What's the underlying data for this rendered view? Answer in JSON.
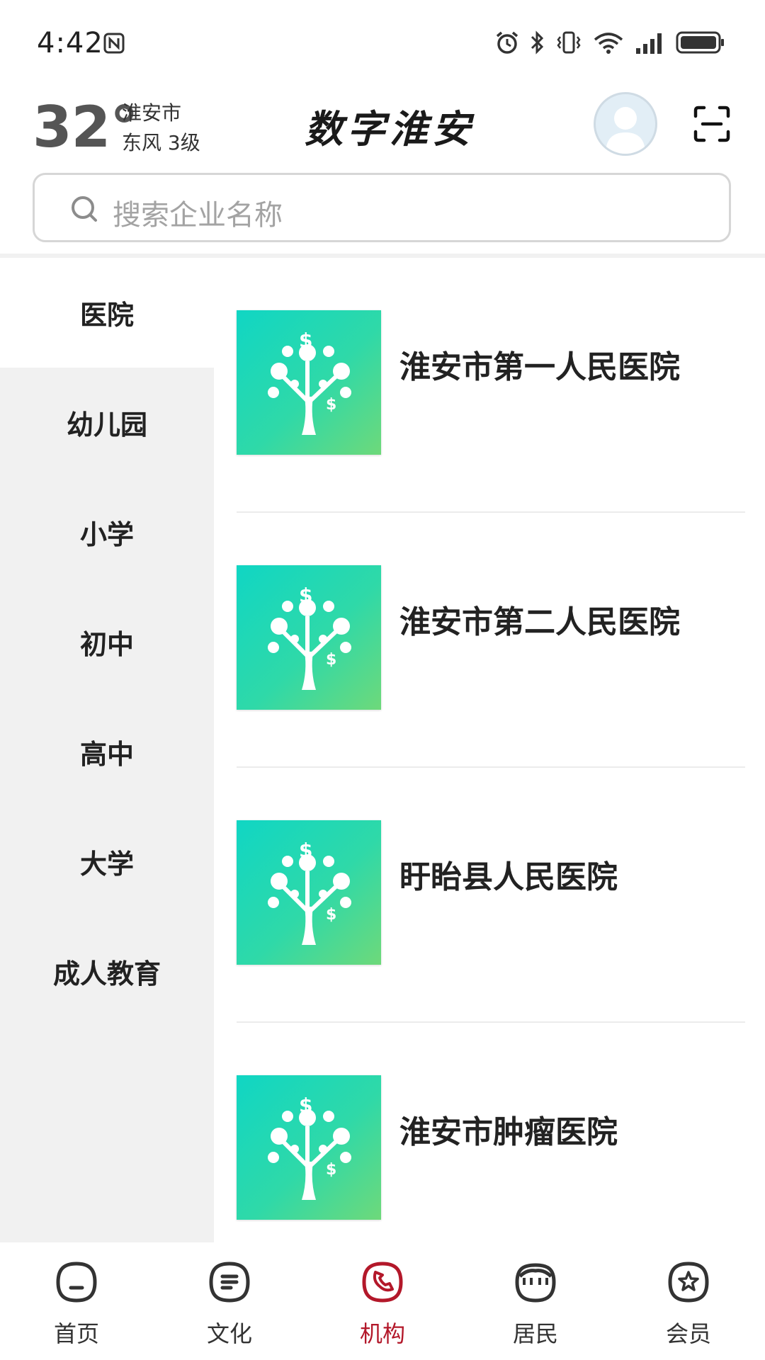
{
  "status_bar": {
    "time": "4:42",
    "icons": [
      "nfc-icon",
      "alarm-icon",
      "bluetooth-icon",
      "vibrate-icon",
      "wifi-icon",
      "signal-icon",
      "battery-icon"
    ]
  },
  "header": {
    "temperature": "32°",
    "city": "淮安市",
    "wind": "东风  3级",
    "title": "数字淮安"
  },
  "search": {
    "placeholder": "搜索企业名称"
  },
  "sidebar": {
    "items": [
      {
        "label": "医院",
        "active": true
      },
      {
        "label": "幼儿园",
        "active": false
      },
      {
        "label": "小学",
        "active": false
      },
      {
        "label": "初中",
        "active": false
      },
      {
        "label": "高中",
        "active": false
      },
      {
        "label": "大学",
        "active": false
      },
      {
        "label": "成人教育",
        "active": false
      }
    ]
  },
  "list": {
    "items": [
      {
        "name": "淮安市第一人民医院"
      },
      {
        "name": "淮安市第二人民医院"
      },
      {
        "name": "盱眙县人民医院"
      },
      {
        "name": "淮安市肿瘤医院"
      }
    ]
  },
  "bottom_nav": {
    "items": [
      {
        "label": "首页",
        "icon": "home-icon",
        "active": false
      },
      {
        "label": "文化",
        "icon": "document-icon",
        "active": false
      },
      {
        "label": "机构",
        "icon": "phone-icon",
        "active": true
      },
      {
        "label": "居民",
        "icon": "store-icon",
        "active": false
      },
      {
        "label": "会员",
        "icon": "star-badge-icon",
        "active": false
      }
    ]
  },
  "colors": {
    "accent": "#b3182a",
    "sidebar_bg": "#f1f1f1",
    "thumb_gradient_start": "#10d6c4",
    "thumb_gradient_end": "#6ed97a"
  }
}
